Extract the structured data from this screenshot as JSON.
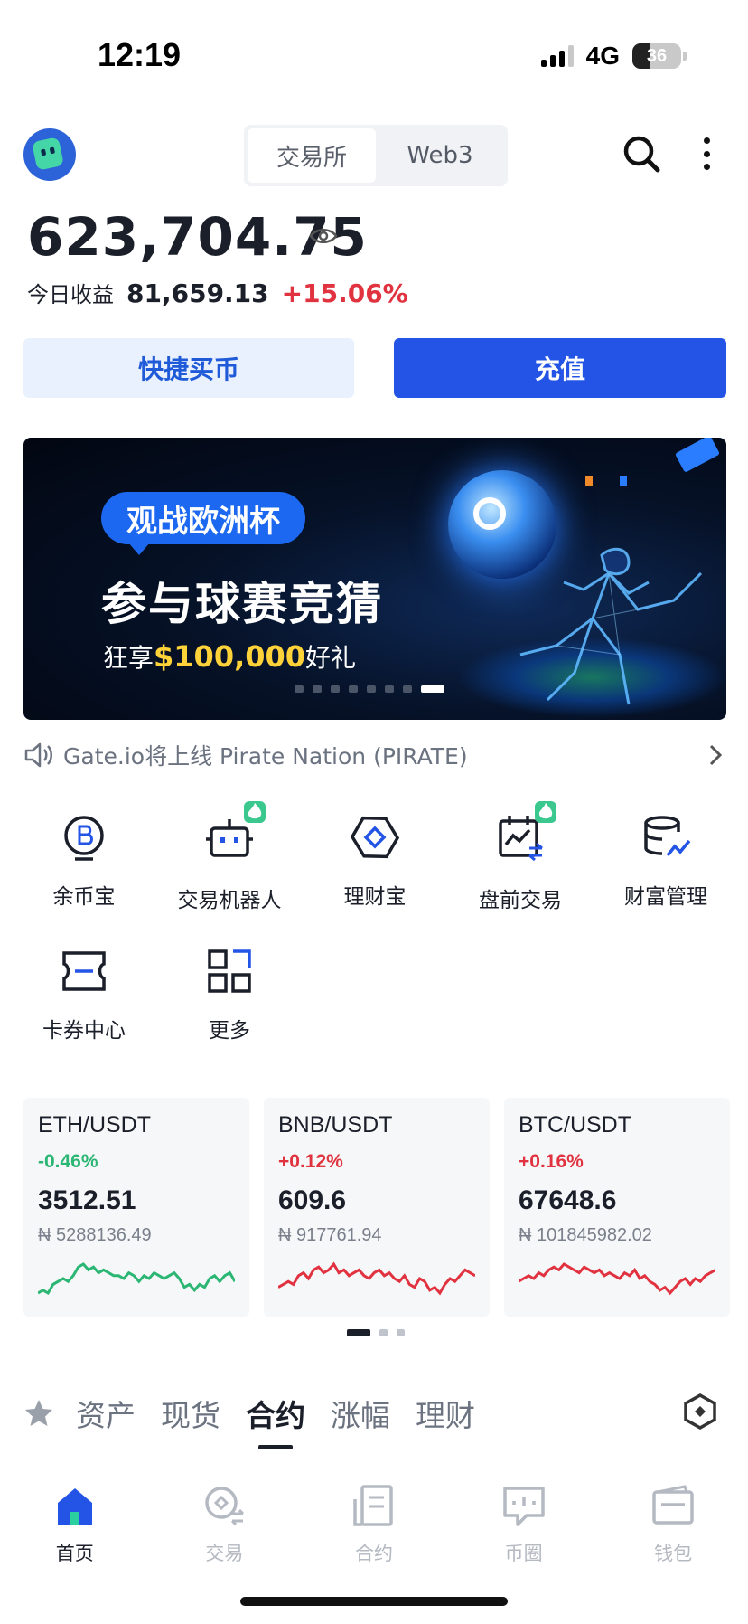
{
  "status_bar": {
    "time": "12:19",
    "network": "4G",
    "battery": "36",
    "battery_level": 0.36
  },
  "header": {
    "segments": [
      {
        "label": "交易所",
        "active": true
      },
      {
        "label": "Web3",
        "active": false
      }
    ],
    "icons": [
      "avatar",
      "search-icon",
      "more-vertical-icon"
    ]
  },
  "account": {
    "balance": "623,704.75",
    "today_pnl_label": "今日收益",
    "today_pnl_value": "81,659.13",
    "today_pnl_pct": "+15.06%"
  },
  "actions": {
    "quick_buy": "快捷买币",
    "deposit": "充值"
  },
  "banner": {
    "tag": "观战欧洲杯",
    "title": "参与球赛竞猜",
    "sub_prefix": "狂享",
    "sub_amount": "$100,000",
    "sub_suffix": "好礼",
    "slide_count": 8,
    "active_slide": 7
  },
  "announcement": {
    "text": "Gate.io将上线 Pirate Nation (PIRATE)"
  },
  "features": [
    {
      "label": "余币宝",
      "icon": "coin-b-icon",
      "hot": false
    },
    {
      "label": "交易机器人",
      "icon": "robot-icon",
      "hot": true
    },
    {
      "label": "理财宝",
      "icon": "hex-diamond-icon",
      "hot": false
    },
    {
      "label": "盘前交易",
      "icon": "calendar-chart-icon",
      "hot": true
    },
    {
      "label": "财富管理",
      "icon": "coins-stack-icon",
      "hot": false
    },
    {
      "label": "卡券中心",
      "icon": "ticket-icon",
      "hot": false
    },
    {
      "label": "更多",
      "icon": "grid-icon",
      "hot": false
    }
  ],
  "markets": [
    {
      "pair": "ETH/USDT",
      "change": "-0.46%",
      "price": "3512.51",
      "fiat": "₦ 5288136.49",
      "trend": "down",
      "sparkline": [
        6,
        7,
        6,
        9,
        10,
        11,
        10,
        12,
        15,
        16,
        14,
        15,
        13,
        14,
        13,
        12,
        12,
        11,
        13,
        12,
        10,
        12,
        11,
        13,
        12,
        11,
        12,
        13,
        11,
        8,
        9,
        7,
        9,
        8,
        11,
        12,
        10,
        12,
        13,
        10
      ]
    },
    {
      "pair": "BNB/USDT",
      "change": "+0.12%",
      "price": "609.6",
      "fiat": "₦ 917761.94",
      "trend": "up",
      "sparkline": [
        7,
        8,
        9,
        8,
        11,
        12,
        10,
        13,
        14,
        12,
        13,
        15,
        12,
        13,
        11,
        12,
        13,
        11,
        10,
        12,
        13,
        11,
        12,
        10,
        9,
        11,
        8,
        7,
        10,
        9,
        6,
        7,
        5,
        8,
        10,
        9,
        11,
        13,
        12,
        11
      ]
    },
    {
      "pair": "BTC/USDT",
      "change": "+0.16%",
      "price": "67648.6",
      "fiat": "₦ 101845982.02",
      "trend": "up",
      "sparkline": [
        8,
        9,
        10,
        9,
        11,
        10,
        12,
        13,
        12,
        14,
        13,
        12,
        11,
        13,
        12,
        11,
        12,
        10,
        11,
        10,
        9,
        11,
        10,
        12,
        9,
        10,
        8,
        7,
        5,
        6,
        4,
        6,
        8,
        9,
        7,
        9,
        8,
        10,
        11,
        12
      ]
    }
  ],
  "market_pages": {
    "count": 3,
    "active": 0
  },
  "colors": {
    "brand": "#2354e6",
    "up": "#e0323f",
    "down": "#2bb673",
    "hot": "#3bc88f"
  },
  "tabs": [
    {
      "label": "资产",
      "active": false
    },
    {
      "label": "现货",
      "active": false
    },
    {
      "label": "合约",
      "active": true
    },
    {
      "label": "涨幅",
      "active": false
    },
    {
      "label": "理财",
      "active": false
    }
  ],
  "bottom_nav": [
    {
      "label": "首页",
      "icon": "home-icon",
      "active": true
    },
    {
      "label": "交易",
      "icon": "trade-icon",
      "active": false
    },
    {
      "label": "合约",
      "icon": "contract-icon",
      "active": false
    },
    {
      "label": "币圈",
      "icon": "chat-icon",
      "active": false
    },
    {
      "label": "钱包",
      "icon": "wallet-icon",
      "active": false
    }
  ]
}
